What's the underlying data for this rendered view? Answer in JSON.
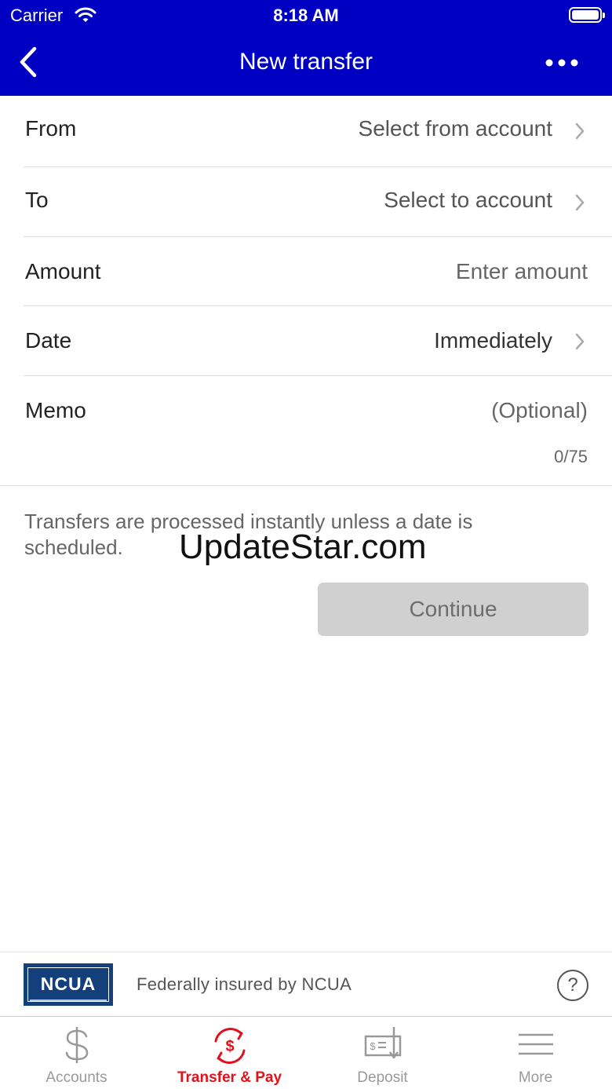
{
  "status_bar": {
    "carrier": "Carrier",
    "time": "8:18 AM",
    "icons": [
      "wifi-icon",
      "battery-icon"
    ]
  },
  "nav": {
    "title": "New transfer",
    "back_icon": "chevron-left-icon",
    "more_icon": "more-dots-icon",
    "bar_color": "#0000c3"
  },
  "form": {
    "from": {
      "label": "From",
      "value": "Select from account"
    },
    "to": {
      "label": "To",
      "value": "Select to account"
    },
    "amount": {
      "label": "Amount",
      "placeholder": "Enter amount"
    },
    "date": {
      "label": "Date",
      "value": "Immediately"
    },
    "memo": {
      "label": "Memo",
      "placeholder": "(Optional)",
      "counter": "0/75"
    }
  },
  "note": "Transfers are processed instantly unless a date is scheduled.",
  "watermark": "UpdateStar.com",
  "continue_button": {
    "label": "Continue",
    "enabled": false
  },
  "footer": {
    "logo_text": "NCUA",
    "insured_text": "Federally insured by NCUA",
    "help_icon": "help-circle-icon",
    "help_glyph": "?"
  },
  "tabs": [
    {
      "label": "Accounts",
      "icon": "dollar-icon",
      "active": false
    },
    {
      "label": "Transfer & Pay",
      "icon": "transfer-pay-icon",
      "active": true
    },
    {
      "label": "Deposit",
      "icon": "check-deposit-icon",
      "active": false
    },
    {
      "label": "More",
      "icon": "menu-icon",
      "active": false
    }
  ],
  "colors": {
    "accent": "#e0121c",
    "inactive_tab": "#999999",
    "ncua_blue": "#13407a"
  }
}
